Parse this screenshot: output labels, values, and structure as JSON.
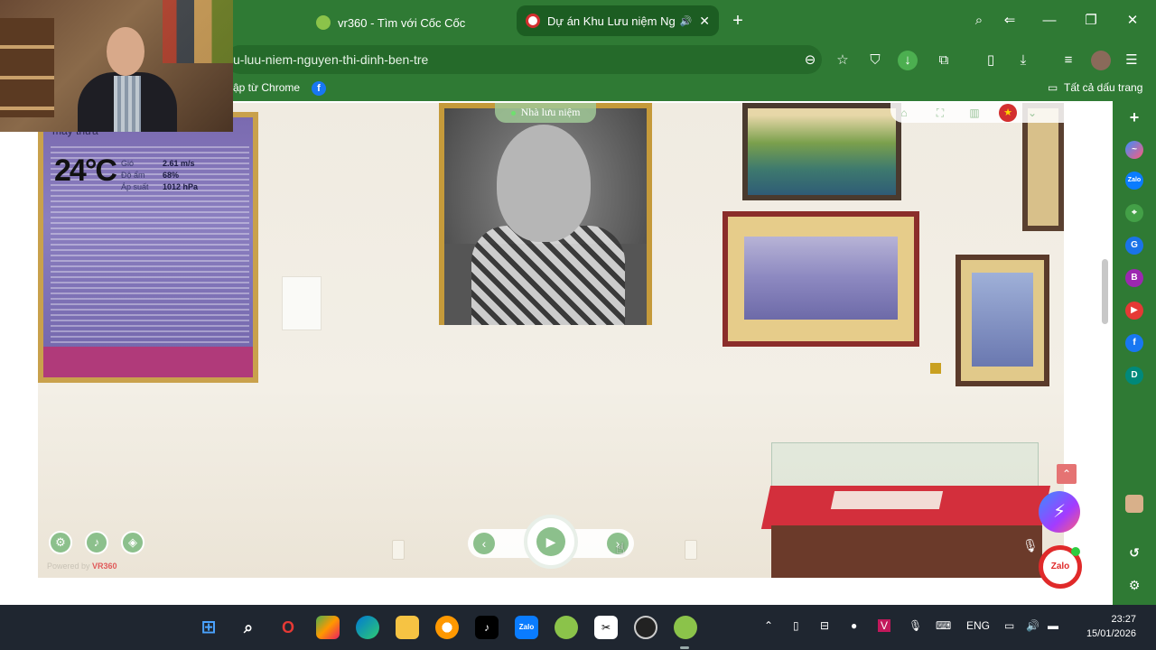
{
  "browser": {
    "tabs": [
      {
        "label": "vr360 - Tìm với Cốc Cốc",
        "active": false
      },
      {
        "label": "Dự án Khu Lưu niệm Ng",
        "active": true
      }
    ],
    "url": "u-luu-niem-nguyen-thi-dinh-ben-tre",
    "bookmarks": {
      "import_label": "ập từ Chrome",
      "all_bookmarks_label": "Tất cả dấu trang"
    },
    "theme_color": "#2f7a34"
  },
  "tour": {
    "scene_name": "Nhà lưu niệm",
    "weather": {
      "city": "mây thưa",
      "temperature": "24°C",
      "rows": [
        {
          "key": "Gió",
          "value": "2.61 m/s"
        },
        {
          "key": "Độ ẩm",
          "value": "68%"
        },
        {
          "key": "Áp suất",
          "value": "1012 hPa"
        }
      ]
    },
    "powered_by": "Powered by",
    "powered_brand": "VR360",
    "zalo_label": "Zalo"
  },
  "sidebar": {
    "icons": [
      "plus-icon",
      "messenger-icon",
      "zalo-icon",
      "game-icon",
      "translate-icon",
      "b-icon",
      "youtube-icon",
      "facebook-icon",
      "d-icon",
      "avatar",
      "history-icon",
      "settings-icon"
    ]
  },
  "taskbar": {
    "language": "ENG",
    "time": "23:27",
    "date": "15/01/2026"
  }
}
